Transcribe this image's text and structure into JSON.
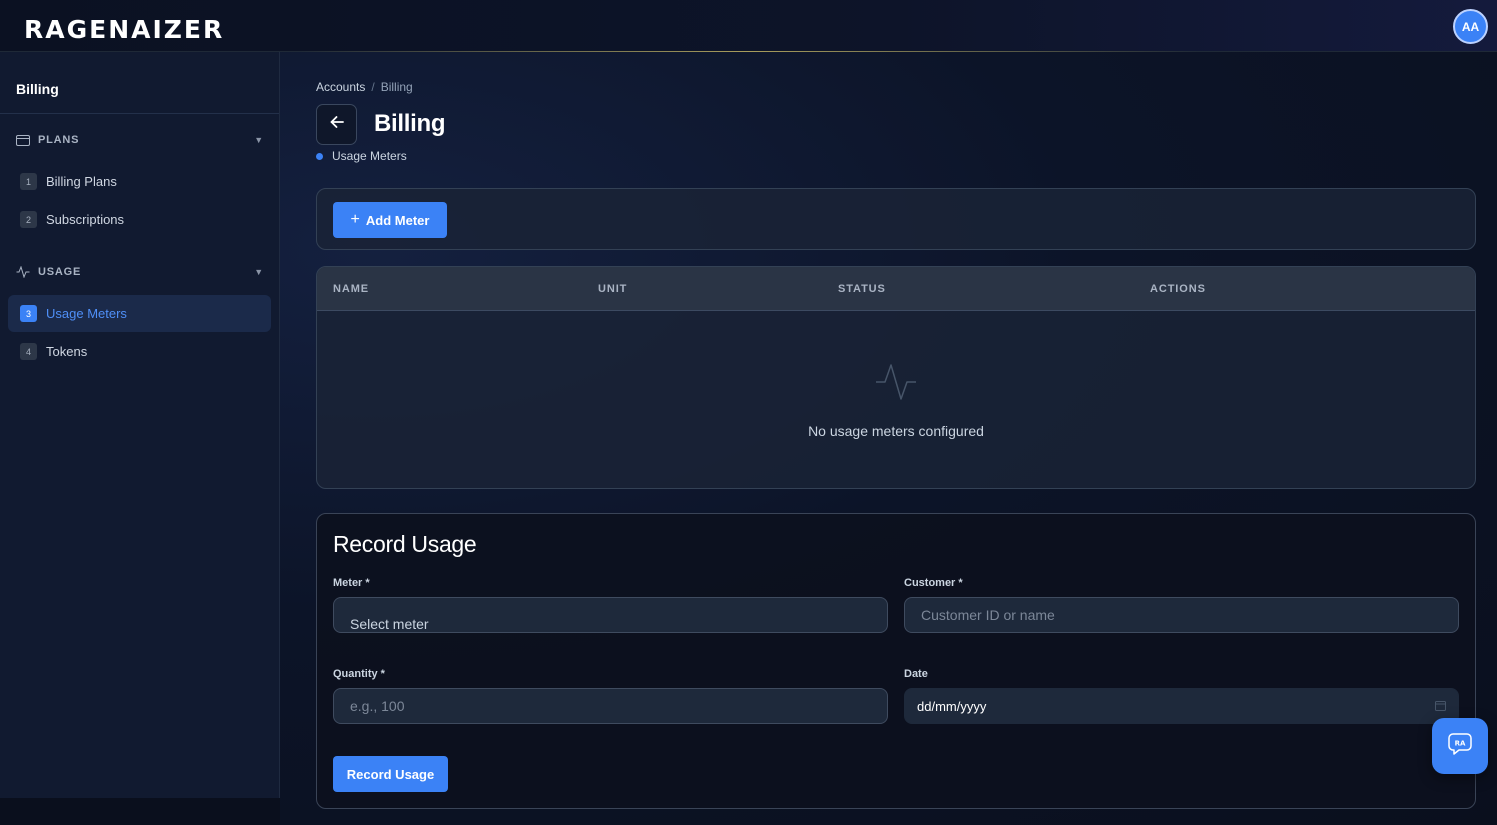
{
  "app": {
    "logo": "RAGENAIZER",
    "user_initials": "AA"
  },
  "sidebar": {
    "title": "Billing",
    "sections": [
      {
        "label": "PLANS",
        "icon": "credit-card-icon"
      },
      {
        "label": "USAGE",
        "icon": "activity-icon"
      }
    ],
    "items": [
      {
        "num": "1",
        "label": "Billing Plans"
      },
      {
        "num": "2",
        "label": "Subscriptions"
      },
      {
        "num": "3",
        "label": "Usage Meters",
        "active": true
      },
      {
        "num": "4",
        "label": "Tokens"
      }
    ]
  },
  "breadcrumb": {
    "parent": "Accounts",
    "separator": "/",
    "current": "Billing"
  },
  "page": {
    "title": "Billing",
    "subtitle": "Usage Meters"
  },
  "toolbar": {
    "add_label": "Add Meter"
  },
  "table": {
    "columns": [
      "NAME",
      "UNIT",
      "STATUS",
      "ACTIONS"
    ],
    "empty_text": "No usage meters configured",
    "rows": []
  },
  "record": {
    "title": "Record Usage",
    "meter_label": "Meter *",
    "meter_value": "Select meter",
    "customer_label": "Customer *",
    "customer_placeholder": "Customer ID or name",
    "quantity_label": "Quantity *",
    "quantity_placeholder": "e.g., 100",
    "date_label": "Date",
    "date_value": "dd/mm/yyyy",
    "submit_label": "Record Usage"
  },
  "colors": {
    "accent": "#3b82f6",
    "background": "#0c1428",
    "sidebar": "#111a30"
  }
}
